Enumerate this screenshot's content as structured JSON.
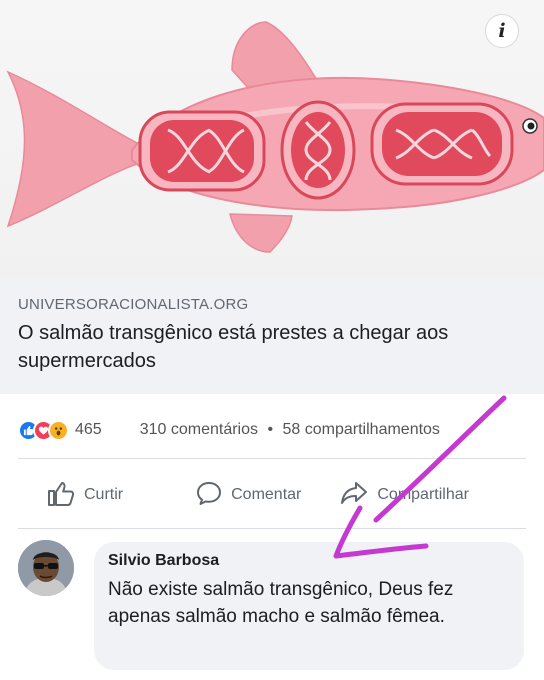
{
  "post": {
    "info_glyph": "i",
    "link_domain": "UNIVERSORACIONALISTA.ORG",
    "link_title": "O salmão transgênico está prestes a chegar aos supermercados",
    "reactions": {
      "icons": [
        "like-icon",
        "love-icon",
        "wow-icon"
      ],
      "count": "465"
    },
    "comments_count": "310 comentários",
    "separator": "•",
    "shares_count": "58 compartilhamentos",
    "actions": {
      "like": "Curtir",
      "comment": "Comentar",
      "share": "Compartilhar"
    }
  },
  "comment": {
    "author": "Silvio Barbosa",
    "text": "Não existe salmão transgênico, Deus fez apenas salmão macho e salmão fêmea."
  },
  "colors": {
    "fish_body": "#f4a3b0",
    "dna_window": "#e04a5c",
    "link_box_bg": "#f0f2f5",
    "annotation_arrow": "#c43ad0",
    "like_blue": "#1877f2"
  }
}
